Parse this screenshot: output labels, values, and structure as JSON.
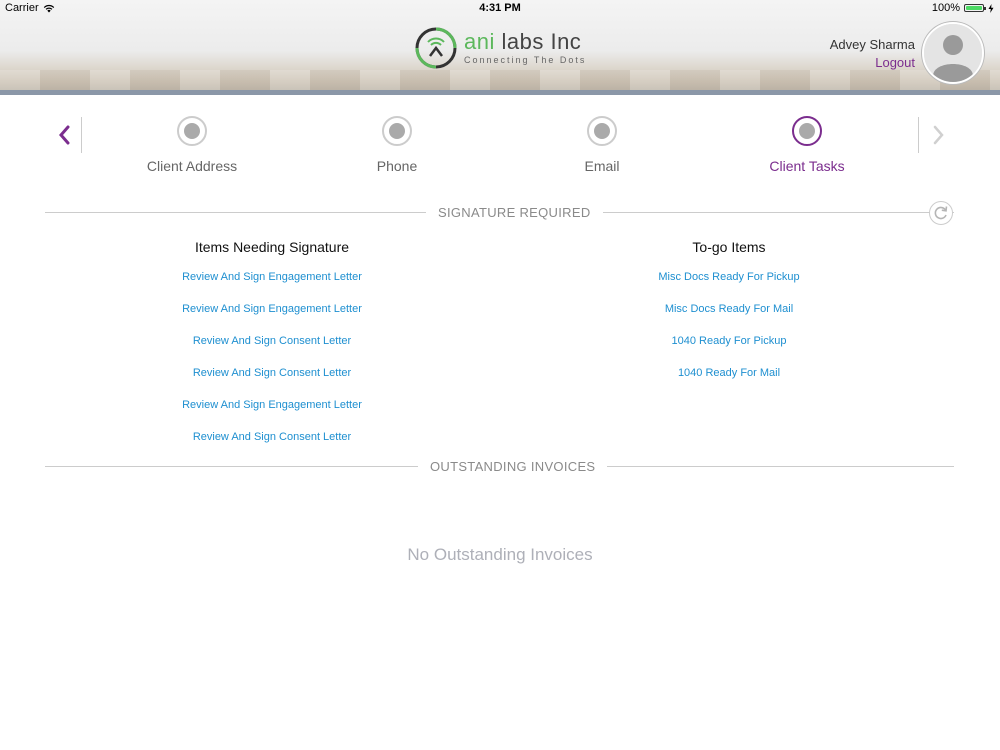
{
  "status_bar": {
    "carrier": "Carrier",
    "time": "4:31 PM",
    "battery": "100%",
    "battery_level": 1.0
  },
  "header": {
    "brand_prefix": "ani",
    "brand_suffix": "labs Inc",
    "tagline": "Connecting The Dots",
    "user_name": "Advey Sharma",
    "logout_label": "Logout"
  },
  "steps": [
    {
      "label": "Client Address",
      "active": false
    },
    {
      "label": "Phone",
      "active": false
    },
    {
      "label": "Email",
      "active": false
    },
    {
      "label": "Client Tasks",
      "active": true
    }
  ],
  "signature_section": {
    "title": "SIGNATURE REQUIRED",
    "left": {
      "heading": "Items Needing Signature",
      "items": [
        "Review And Sign Engagement Letter",
        "Review And Sign Engagement Letter",
        "Review And Sign Consent Letter",
        "Review And Sign Consent Letter",
        "Review And Sign Engagement Letter",
        "Review And Sign Consent Letter"
      ]
    },
    "right": {
      "heading": "To-go Items",
      "items": [
        "Misc Docs Ready For Pickup",
        "Misc Docs Ready For Mail",
        "1040 Ready For Pickup",
        "1040 Ready For Mail"
      ]
    }
  },
  "invoices_section": {
    "title": "OUTSTANDING INVOICES",
    "empty_message": "No Outstanding Invoices"
  },
  "colors": {
    "accent_purple": "#7b2d8e",
    "link_blue": "#1e8fd0",
    "logo_green": "#5cb85c"
  },
  "icons": [
    "wifi-icon",
    "battery-icon",
    "logo-icon",
    "avatar-icon",
    "chevron-left-icon",
    "chevron-right-icon",
    "refresh-icon"
  ]
}
